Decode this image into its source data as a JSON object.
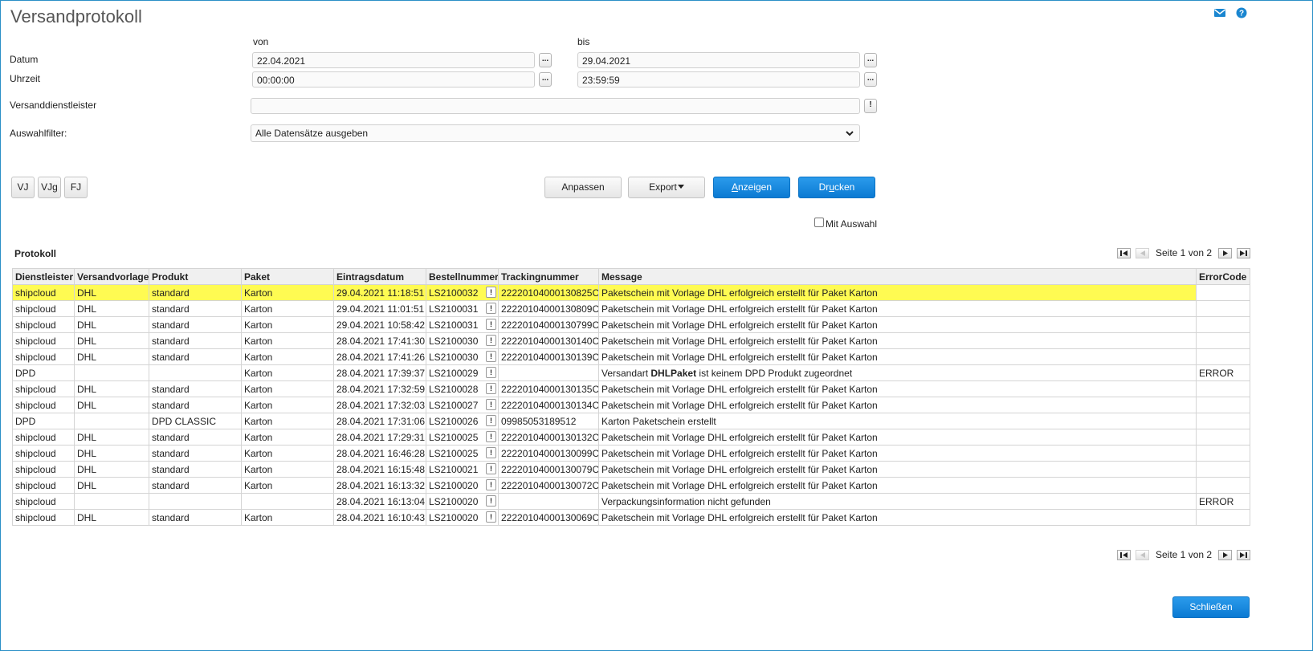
{
  "header": {
    "title": "Versandprotokoll"
  },
  "filters": {
    "von_label": "von",
    "bis_label": "bis",
    "datum_label": "Datum",
    "uhrzeit_label": "Uhrzeit",
    "datum_von": "22.04.2021",
    "datum_bis": "29.04.2021",
    "uhrzeit_von": "00:00:00",
    "uhrzeit_bis": "23:59:59",
    "picker_label": "...",
    "versanddienstleister_label": "Versanddienstleister",
    "versanddienstleister_value": "",
    "auswahlfilter_label": "Auswahlfilter:",
    "auswahlfilter_value": "Alle Datensätze ausgeben",
    "lookup_label": "!"
  },
  "quick_buttons": [
    "VJ",
    "VJg",
    "FJ"
  ],
  "actions": {
    "anpassen": "Anpassen",
    "export": "Export",
    "anzeigen_pre": "",
    "anzeigen_acc": "A",
    "anzeigen_post": "nzeigen",
    "drucken_pre": "Dr",
    "drucken_acc": "u",
    "drucken_post": "cken",
    "mit_auswahl": "Mit Auswahl"
  },
  "section": {
    "title": "Protokoll"
  },
  "pagination": {
    "text": "Seite 1 von 2"
  },
  "colors": {
    "accent": "#0b7ad3",
    "highlight": "#fffb52",
    "frame": "#2a8fc7"
  },
  "table": {
    "columns": [
      "Dienstleister",
      "Versandvorlage",
      "Produkt",
      "Paket",
      "Eintragsdatum",
      "Bestellnummer",
      "Trackingnummer",
      "Message",
      "ErrorCode"
    ],
    "rows": [
      [
        "shipcloud",
        "DHL",
        "standard",
        "Karton",
        "29.04.2021 11:18:51",
        "LS2100032",
        "22220104000130825C",
        "Paketschein mit Vorlage DHL erfolgreich erstellt für Paket Karton",
        ""
      ],
      [
        "shipcloud",
        "DHL",
        "standard",
        "Karton",
        "29.04.2021 11:01:51",
        "LS2100031",
        "22220104000130809C",
        "Paketschein mit Vorlage DHL erfolgreich erstellt für Paket Karton",
        ""
      ],
      [
        "shipcloud",
        "DHL",
        "standard",
        "Karton",
        "29.04.2021 10:58:42",
        "LS2100031",
        "22220104000130799C",
        "Paketschein mit Vorlage DHL erfolgreich erstellt für Paket Karton",
        ""
      ],
      [
        "shipcloud",
        "DHL",
        "standard",
        "Karton",
        "28.04.2021 17:41:30",
        "LS2100030",
        "22220104000130140C",
        "Paketschein mit Vorlage DHL erfolgreich erstellt für Paket Karton",
        ""
      ],
      [
        "shipcloud",
        "DHL",
        "standard",
        "Karton",
        "28.04.2021 17:41:26",
        "LS2100030",
        "22220104000130139C",
        "Paketschein mit Vorlage DHL erfolgreich erstellt für Paket Karton",
        ""
      ],
      [
        "DPD",
        "",
        "",
        "Karton",
        "28.04.2021 17:39:37",
        "LS2100029",
        "",
        "Versandart DHLPaket ist keinem DPD Produkt zugeordnet",
        "ERROR"
      ],
      [
        "shipcloud",
        "DHL",
        "standard",
        "Karton",
        "28.04.2021 17:32:59",
        "LS2100028",
        "22220104000130135C",
        "Paketschein mit Vorlage DHL erfolgreich erstellt für Paket Karton",
        ""
      ],
      [
        "shipcloud",
        "DHL",
        "standard",
        "Karton",
        "28.04.2021 17:32:03",
        "LS2100027",
        "22220104000130134C",
        "Paketschein mit Vorlage DHL erfolgreich erstellt für Paket Karton",
        ""
      ],
      [
        "DPD",
        "",
        "DPD CLASSIC",
        "Karton",
        "28.04.2021 17:31:06",
        "LS2100026",
        "09985053189512",
        "Karton Paketschein erstellt",
        ""
      ],
      [
        "shipcloud",
        "DHL",
        "standard",
        "Karton",
        "28.04.2021 17:29:31",
        "LS2100025",
        "22220104000130132C",
        "Paketschein mit Vorlage DHL erfolgreich erstellt für Paket Karton",
        ""
      ],
      [
        "shipcloud",
        "DHL",
        "standard",
        "Karton",
        "28.04.2021 16:46:28",
        "LS2100025",
        "22220104000130099C",
        "Paketschein mit Vorlage DHL erfolgreich erstellt für Paket Karton",
        ""
      ],
      [
        "shipcloud",
        "DHL",
        "standard",
        "Karton",
        "28.04.2021 16:15:48",
        "LS2100021",
        "22220104000130079C",
        "Paketschein mit Vorlage DHL erfolgreich erstellt für Paket Karton",
        ""
      ],
      [
        "shipcloud",
        "DHL",
        "standard",
        "Karton",
        "28.04.2021 16:13:32",
        "LS2100020",
        "22220104000130072C",
        "Paketschein mit Vorlage DHL erfolgreich erstellt für Paket Karton",
        ""
      ],
      [
        "shipcloud",
        "",
        "",
        "",
        "28.04.2021 16:13:04",
        "LS2100020",
        "",
        "Verpackungsinformation nicht gefunden",
        "ERROR"
      ],
      [
        "shipcloud",
        "DHL",
        "standard",
        "Karton",
        "28.04.2021 16:10:43",
        "LS2100020",
        "22220104000130069C",
        "Paketschein mit Vorlage DHL erfolgreich erstellt für Paket Karton",
        ""
      ]
    ],
    "bold_word": "DHLPaket",
    "button_label": "!"
  },
  "footer": {
    "close": "Schließen"
  }
}
